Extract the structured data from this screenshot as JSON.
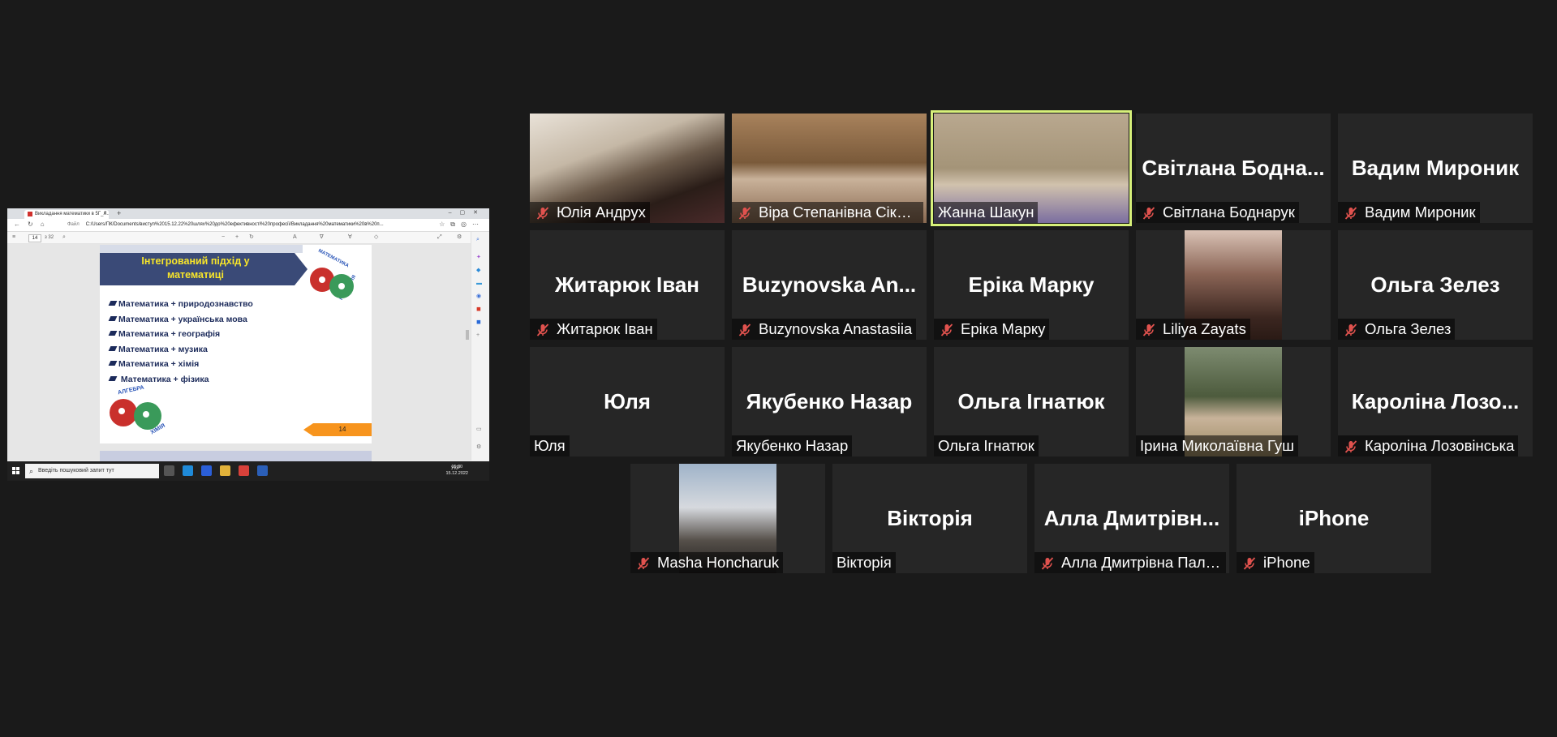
{
  "shared_screen": {
    "tab_title": "Викладання математики в 5Г_Л...",
    "tab_close": "×",
    "new_tab": "+",
    "address_label": "Файл",
    "address_url": "C:/Users/ПК/Documents/виступ%2015.12.22%20шлях%20до%20ефективності%20професії/Викладання%20математики%20в%20п...",
    "page_number": "14",
    "page_of": "з 32",
    "slide": {
      "title": "Інтегрований підхід у математиці",
      "gears_top_label_1": "МАТЕМАТИКА",
      "gears_top_label_2": "ГЕОГРАФІЯ",
      "gears_bottom_label_1": "АЛГЕБРА",
      "gears_bottom_label_2": "ХІМІЯ",
      "items": [
        "Математика + природознавство",
        "Математика + українська мова",
        "Математика + географія",
        "Математика + музика",
        "Математика + хімія",
        " Математика + фізика"
      ],
      "slide_number": "14"
    },
    "taskbar": {
      "search_placeholder": "Введіть пошуковий запит тут",
      "tray_lang": "УКР",
      "time": "15:20",
      "date": "15.12.2022"
    }
  },
  "participants": [
    {
      "name": "Юлія Андрух",
      "muted": true,
      "video": true,
      "speaking": false
    },
    {
      "name": "Віра Степанівна Сікора",
      "muted": true,
      "video": true,
      "speaking": false
    },
    {
      "name": "Жанна Шакун",
      "muted": false,
      "video": true,
      "speaking": true
    },
    {
      "name": "Світлана Боднарук",
      "display_name": "Світлана Бодна...",
      "muted": true,
      "video": false
    },
    {
      "name": "Вадим Мироник",
      "display_name": "Вадим Мироник",
      "muted": true,
      "video": false
    },
    {
      "name": "Житарюк Іван",
      "display_name": "Житарюк Іван",
      "muted": true,
      "video": false
    },
    {
      "name": "Buzynovska Anastasiia",
      "display_name": "Buzynovska An...",
      "muted": true,
      "video": false
    },
    {
      "name": "Еріка Марку",
      "display_name": "Еріка Марку",
      "muted": true,
      "video": false
    },
    {
      "name": "Liliya Zayats",
      "muted": true,
      "video": true
    },
    {
      "name": "Ольга Зелез",
      "display_name": "Ольга Зелез",
      "muted": true,
      "video": false
    },
    {
      "name": "Юля",
      "display_name": "Юля",
      "muted": false,
      "video": false
    },
    {
      "name": "Якубенко  Назар",
      "display_name": "Якубенко  Назар",
      "muted": false,
      "video": false
    },
    {
      "name": "Ольга Ігнатюк",
      "display_name": "Ольга Ігнатюк",
      "muted": false,
      "video": false
    },
    {
      "name": "Ірина Миколаївна Гуш",
      "muted": false,
      "video": true
    },
    {
      "name": "Кароліна Лозовінська",
      "display_name": "Кароліна Лозо...",
      "muted": true,
      "video": false
    },
    {
      "name": "Masha Honcharuk",
      "muted": true,
      "video": true
    },
    {
      "name": "Вікторія",
      "display_name": "Вікторія",
      "muted": false,
      "video": false
    },
    {
      "name": "Алла Дмитрівна Пала...",
      "display_name": "Алла Дмитрівн...",
      "muted": true,
      "video": false
    },
    {
      "name": "iPhone",
      "display_name": "iPhone",
      "muted": true,
      "video": false
    }
  ],
  "colors": {
    "background": "#1a1a1a",
    "tile": "#262626",
    "speaking_border": "#d7f07a",
    "mute_icon": "#e0524e"
  }
}
